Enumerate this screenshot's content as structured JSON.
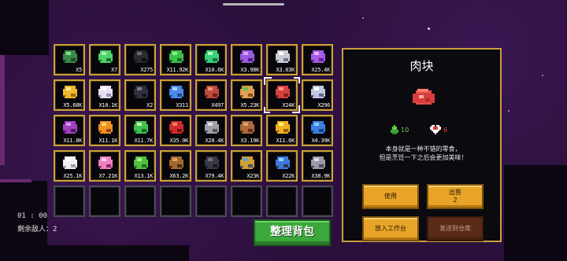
{
  "bag": {
    "rows": [
      [
        {
          "icon": "green-chest-icon",
          "count": "X5"
        },
        {
          "icon": "green-potion-icon",
          "count": "X7"
        },
        {
          "icon": "black-cube-icon",
          "count": "X275"
        },
        {
          "icon": "green-slime-icon",
          "count": "X11.92K"
        },
        {
          "icon": "green-leaf-icon",
          "count": "X10.6K"
        },
        {
          "icon": "purple-wand-icon",
          "count": "X3.98K"
        },
        {
          "icon": "silver-ore-icon",
          "count": "X3.03K"
        },
        {
          "icon": "purple-crystal-icon",
          "count": "X25.4K"
        }
      ],
      [
        {
          "icon": "gold-star-icon",
          "count": "X5.68K"
        },
        {
          "icon": "white-crystal-icon",
          "count": "X10.1K"
        },
        {
          "icon": "dark-cube-icon",
          "count": "X2"
        },
        {
          "icon": "blue-potion-icon",
          "count": "X311"
        },
        {
          "icon": "meat-icon",
          "count": "X497"
        },
        {
          "icon": "sandwich-icon",
          "count": "X5.23K"
        },
        {
          "icon": "raw-meat-icon",
          "count": "X24K",
          "selected": true
        },
        {
          "icon": "silver-sword-icon",
          "count": "X296"
        }
      ],
      [
        {
          "icon": "purple-ore-icon",
          "count": "X11.8K"
        },
        {
          "icon": "orange-gem-icon",
          "count": "X11.1K"
        },
        {
          "icon": "green-scroll-icon",
          "count": "X11.7K"
        },
        {
          "icon": "red-gem-icon",
          "count": "X35.9K"
        },
        {
          "icon": "iron-ingot-icon",
          "count": "X20.4K"
        },
        {
          "icon": "brown-bread-icon",
          "count": "X3.19K"
        },
        {
          "icon": "gold-bar-icon",
          "count": "X11.6K"
        },
        {
          "icon": "blue-bar-icon",
          "count": "X4.39K"
        }
      ],
      [
        {
          "icon": "white-egg-icon",
          "count": "X25.1K"
        },
        {
          "icon": "pink-crystal-icon",
          "count": "X7.21K"
        },
        {
          "icon": "green-blob-icon",
          "count": "X13.1K"
        },
        {
          "icon": "wooden-stick-icon",
          "count": "X63.2K"
        },
        {
          "icon": "coal-icon",
          "count": "X79.4K"
        },
        {
          "icon": "mixed-ore-icon",
          "count": "X23K"
        },
        {
          "icon": "blue-ore-icon",
          "count": "X22K"
        },
        {
          "icon": "stone-icon",
          "count": "X38.9K"
        }
      ],
      [
        {
          "icon": "",
          "count": ""
        },
        {
          "icon": "",
          "count": ""
        },
        {
          "icon": "",
          "count": ""
        },
        {
          "icon": "",
          "count": ""
        },
        {
          "icon": "",
          "count": ""
        },
        {
          "icon": "",
          "count": ""
        },
        {
          "icon": "",
          "count": ""
        },
        {
          "icon": "",
          "count": ""
        }
      ]
    ]
  },
  "sort_button": "整理背包",
  "detail": {
    "title": "肉块",
    "icon": "raw-meat-icon",
    "energy_value": "10",
    "health_value": "6",
    "description_line1": "本身就是一种不错的零食，",
    "description_line2": "但是烹饪一下之后会更加美味！",
    "buttons": {
      "use": "使用",
      "sell_label": "出售",
      "sell_count": "2",
      "add_to_bench": "放入工作台",
      "send_to_warehouse": "发送到仓库"
    }
  },
  "hud": {
    "timer": "01 : 00",
    "enemies_left": "剩余敌人：2"
  },
  "colors": {
    "slot_border": "#caa13a",
    "panel_border": "#c8a040",
    "sort_button": "#3aa83a",
    "action_button": "#e8a428",
    "disabled_button": "#5a2a18"
  }
}
